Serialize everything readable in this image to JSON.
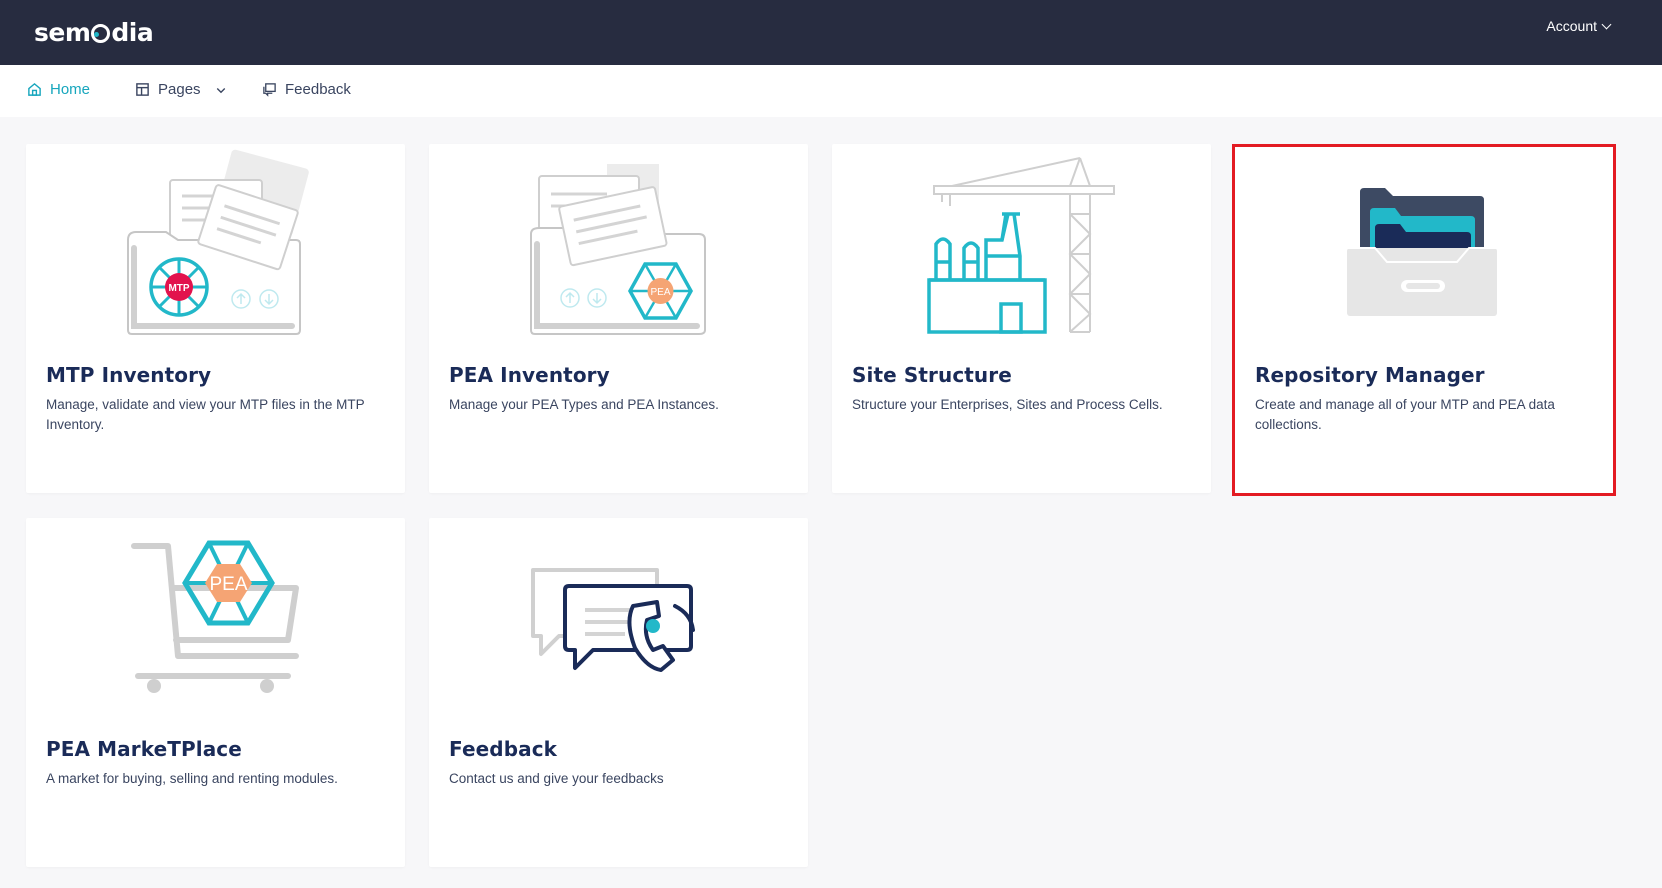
{
  "header": {
    "logo_text": "semedia",
    "logo_prefix": "sem",
    "logo_suffix": "dia",
    "account_label": "Account"
  },
  "nav": {
    "items": [
      {
        "label": "Home",
        "icon": "home-icon",
        "active": true
      },
      {
        "label": "Pages",
        "icon": "layout-icon",
        "has_dropdown": true
      },
      {
        "label": "Feedback",
        "icon": "feedback-icon"
      }
    ]
  },
  "cards": [
    {
      "title": "MTP Inventory",
      "description": "Manage, validate and view your MTP files in the MTP Inventory.",
      "icon": "mtp-folder-icon",
      "badge": "MTP"
    },
    {
      "title": "PEA Inventory",
      "description": "Manage your PEA Types and PEA Instances.",
      "icon": "pea-folder-icon",
      "badge": "PEA"
    },
    {
      "title": "Site Structure",
      "description": "Structure your Enterprises, Sites and Process Cells.",
      "icon": "factory-crane-icon"
    },
    {
      "title": "Repository Manager",
      "description": "Create and manage all of your MTP and PEA data collections.",
      "icon": "repository-drawer-icon",
      "highlighted": true
    },
    {
      "title": "PEA MarkeTPlace",
      "description": "A market for buying, selling and renting modules.",
      "icon": "pea-cart-icon",
      "badge": "PEA"
    },
    {
      "title": "Feedback",
      "description": "Contact us and give your feedbacks",
      "icon": "chat-phone-icon"
    }
  ],
  "colors": {
    "topbar": "#272c40",
    "accent": "#17a6bd",
    "title": "#1a2b58",
    "highlight": "#e31b23",
    "mtp_badge": "#e2134d",
    "pea_badge": "#f5a474"
  }
}
